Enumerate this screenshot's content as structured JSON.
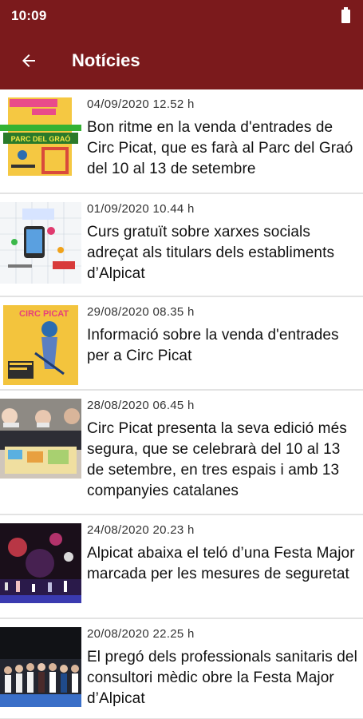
{
  "status_bar": {
    "time": "10:09"
  },
  "app_bar": {
    "title": "Notícies"
  },
  "news": [
    {
      "date": "04/09/2020 12.52 h",
      "title": "Bon ritme en la venda d'entrades de Circ Picat, que es farà al Parc del Graó del 10 al 13 de setembre",
      "thumb_text": "PARC DEL GRAÓ"
    },
    {
      "date": "01/09/2020 10.44 h",
      "title": "Curs gratuït sobre xarxes socials adreçat als titulars dels establiments d’Alpicat"
    },
    {
      "date": "29/08/2020 08.35 h",
      "title": "Informació sobre la venda d'entrades per a Circ Picat",
      "thumb_text": "CIRC PICAT"
    },
    {
      "date": "28/08/2020 06.45 h",
      "title": "Circ Picat presenta la seva edició més segura, que se celebrarà del 10 al 13 de setembre, en tres espais i amb 13 companyies catalanes"
    },
    {
      "date": "24/08/2020 20.23 h",
      "title": "Alpicat abaixa el teló d’una Festa Major marcada per les mesures de seguretat"
    },
    {
      "date": "20/08/2020 22.25 h",
      "title": "El pregó dels professionals sanitaris del consultori mèdic obre la Festa Major d’Alpicat"
    }
  ]
}
